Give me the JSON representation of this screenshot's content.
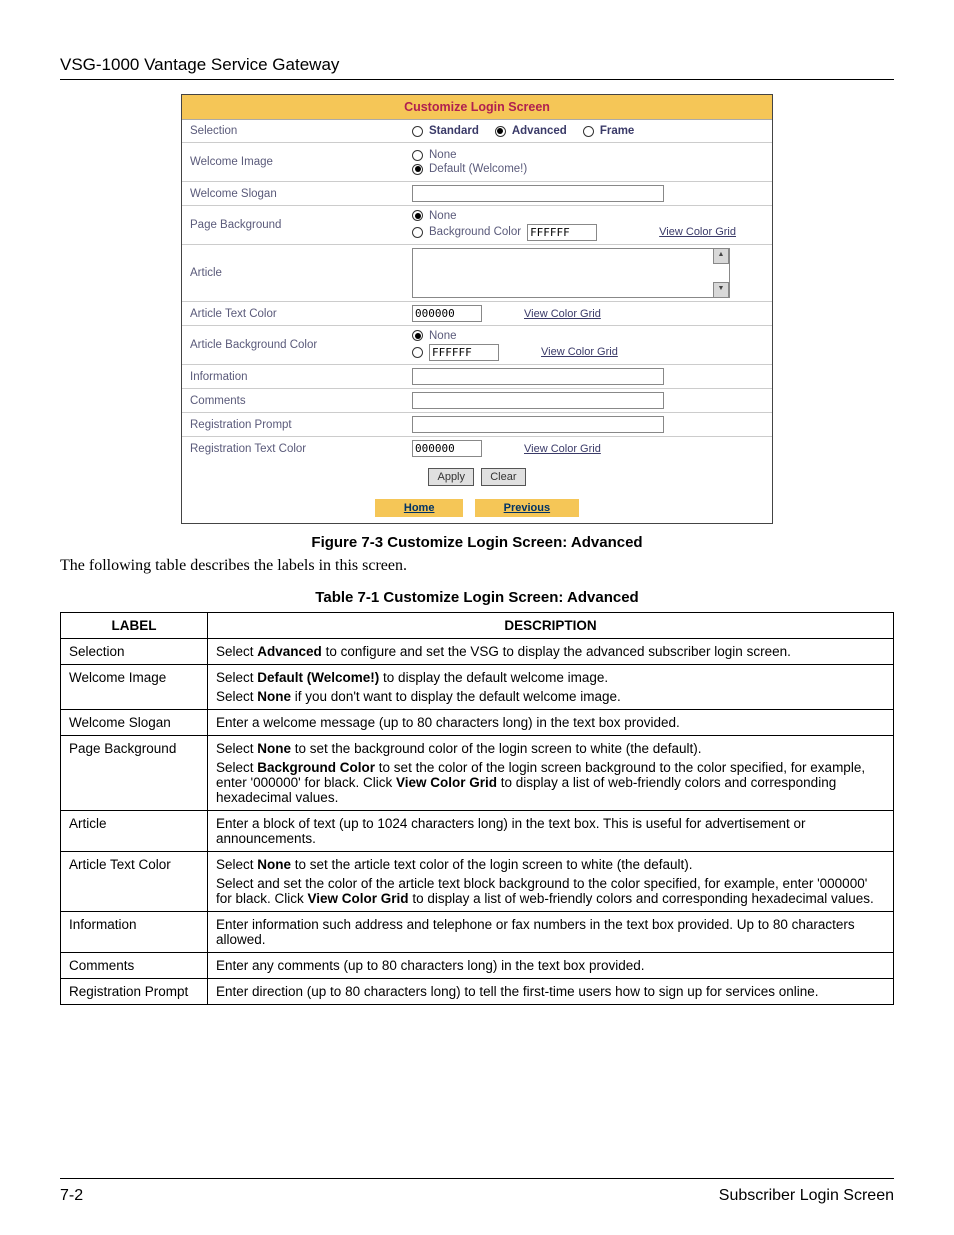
{
  "header": {
    "title": "VSG-1000 Vantage Service Gateway"
  },
  "panel": {
    "title": "Customize Login Screen",
    "rows": {
      "selection": {
        "label": "Selection",
        "opt1": "Standard",
        "opt2": "Advanced",
        "opt3": "Frame"
      },
      "welcomeImage": {
        "label": "Welcome Image",
        "opt1": "None",
        "opt2": "Default (Welcome!)"
      },
      "welcomeSlogan": {
        "label": "Welcome Slogan",
        "value": ""
      },
      "pageBackground": {
        "label": "Page Background",
        "opt1": "None",
        "opt2": "Background Color",
        "colorValue": "FFFFFF",
        "link": "View Color Grid"
      },
      "article": {
        "label": "Article"
      },
      "articleTextColor": {
        "label": "Article Text Color",
        "value": "000000",
        "link": "View Color Grid"
      },
      "articleBgColor": {
        "label": "Article Background Color",
        "opt1": "None",
        "value": "FFFFFF",
        "link": "View Color Grid"
      },
      "information": {
        "label": "Information",
        "value": ""
      },
      "comments": {
        "label": "Comments",
        "value": ""
      },
      "regPrompt": {
        "label": "Registration Prompt",
        "value": ""
      },
      "regTextColor": {
        "label": "Registration Text Color",
        "value": "000000",
        "link": "View Color Grid"
      }
    },
    "buttons": {
      "apply": "Apply",
      "clear": "Clear"
    },
    "nav": {
      "home": "Home",
      "previous": "Previous"
    }
  },
  "figCaption": "Figure 7-3 Customize Login Screen: Advanced",
  "bodyText": "The following table describes the labels in this screen.",
  "tblCaption": "Table 7-1 Customize Login Screen: Advanced",
  "descTable": {
    "header": {
      "label": "LABEL",
      "desc": "DESCRIPTION"
    },
    "rows": [
      {
        "label": "Selection",
        "desc": "Select <b>Advanced</b> to configure and set the VSG to display the advanced subscriber login screen."
      },
      {
        "label": "Welcome Image",
        "desc": "Select <b>Default (Welcome!)</b> to display the default welcome image.<br>Select <b>None</b> if you don't want to display the default welcome image."
      },
      {
        "label": "Welcome Slogan",
        "desc": "Enter a welcome message (up to 80 characters long) in the text box provided."
      },
      {
        "label": "Page Background",
        "desc": "Select <b>None</b> to set the background color of the login screen to white (the default).<br>Select <b>Background Color</b> to set the color of the login screen background to the color specified, for example, enter '000000' for black. Click <b>View Color Grid</b> to display a list of web-friendly colors and corresponding hexadecimal values."
      },
      {
        "label": "Article",
        "desc": "Enter a block of text (up to 1024 characters long) in the text box. This is useful for advertisement or announcements."
      },
      {
        "label": "Article Text Color",
        "desc": "Select <b>None</b> to set the article text color of the login screen to white (the default).<br>Select and set the color of the article text block background to the color specified, for example, enter '000000' for black. Click <b>View Color Grid</b> to display a list of web-friendly colors and corresponding hexadecimal values."
      },
      {
        "label": "Information",
        "desc": "Enter information such address and telephone or fax numbers in the text box provided. Up to 80 characters allowed."
      },
      {
        "label": "Comments",
        "desc": "Enter any comments (up to 80 characters long) in the text box provided."
      },
      {
        "label": "Registration Prompt",
        "desc": "Enter direction (up to 80 characters long)  to tell the first-time users how to sign up for services online."
      }
    ]
  },
  "footer": {
    "left": "7-2",
    "right": "Subscriber Login Screen"
  }
}
